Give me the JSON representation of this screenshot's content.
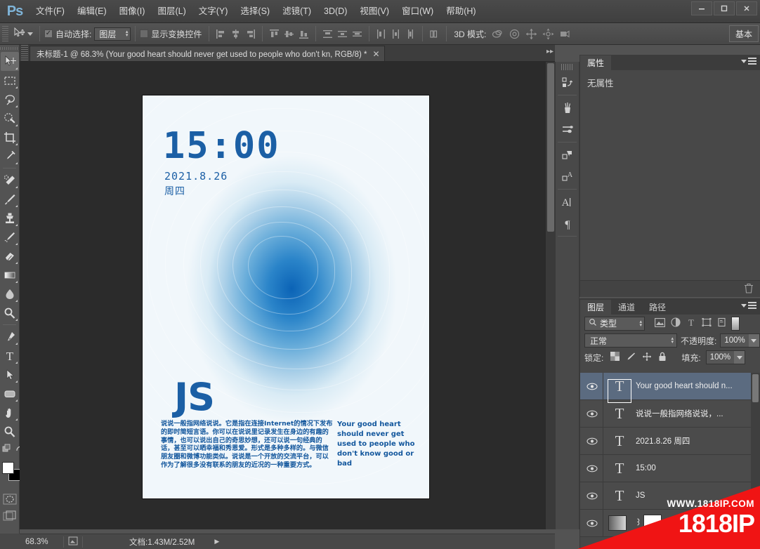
{
  "app": {
    "logo": "Ps",
    "title_suffix": ""
  },
  "window_controls": [
    {
      "name": "minimize",
      "glyph": "—"
    },
    {
      "name": "maximize",
      "glyph": "❐"
    },
    {
      "name": "close",
      "glyph": "✕"
    }
  ],
  "menubar": {
    "items": [
      {
        "label": "文件(F)"
      },
      {
        "label": "编辑(E)"
      },
      {
        "label": "图像(I)"
      },
      {
        "label": "图层(L)"
      },
      {
        "label": "文字(Y)"
      },
      {
        "label": "选择(S)"
      },
      {
        "label": "滤镜(T)"
      },
      {
        "label": "3D(D)"
      },
      {
        "label": "视图(V)"
      },
      {
        "label": "窗口(W)"
      },
      {
        "label": "帮助(H)"
      }
    ]
  },
  "options_bar": {
    "tool_icon": "move-tool-icon",
    "auto_select_label": "自动选择:",
    "auto_select_checked": "✓",
    "layer_select_value": "图层",
    "show_transform_label": "显示变换控件",
    "show_transform_checked": false,
    "mode3d_label": "3D 模式:",
    "workspace_label": "基本"
  },
  "document_tab": {
    "title": "未标题-1 @ 68.3% (Your good heart  should never get  used to people  who don't kn, RGB/8) *",
    "close_glyph": "✕"
  },
  "toolbox": {
    "tools": [
      {
        "name": "move-tool",
        "selected": true
      },
      {
        "name": "rectangular-marquee-tool",
        "selected": false
      },
      {
        "name": "lasso-tool",
        "selected": false
      },
      {
        "name": "quick-selection-tool",
        "selected": false
      },
      {
        "name": "crop-tool",
        "selected": false
      },
      {
        "name": "eyedropper-tool",
        "selected": false
      },
      {
        "name": "healing-brush-tool",
        "selected": false
      },
      {
        "name": "brush-tool",
        "selected": false
      },
      {
        "name": "clone-stamp-tool",
        "selected": false
      },
      {
        "name": "history-brush-tool",
        "selected": false
      },
      {
        "name": "eraser-tool",
        "selected": false
      },
      {
        "name": "gradient-tool",
        "selected": false
      },
      {
        "name": "blur-tool",
        "selected": false
      },
      {
        "name": "dodge-tool",
        "selected": false
      },
      {
        "name": "pen-tool",
        "selected": false
      },
      {
        "name": "horizontal-type-tool",
        "selected": false
      },
      {
        "name": "path-selection-tool",
        "selected": false
      },
      {
        "name": "rounded-rectangle-tool",
        "selected": false
      },
      {
        "name": "hand-tool",
        "selected": false
      },
      {
        "name": "zoom-tool",
        "selected": false
      }
    ],
    "foreground_color": "#ffffff",
    "background_color": "#000000"
  },
  "right_rail": {
    "buttons": [
      {
        "name": "history-panel-icon"
      },
      {
        "name": "brush-presets-icon"
      },
      {
        "name": "brush-panel-icon"
      },
      {
        "name": "paragraph-styles-icon"
      },
      {
        "name": "character-styles-icon"
      },
      {
        "name": "character-panel-icon"
      },
      {
        "name": "paragraph-panel-icon"
      }
    ]
  },
  "properties_panel": {
    "tabs": [
      {
        "label": "属性",
        "active": true
      }
    ],
    "empty_message": "无属性"
  },
  "layers_panel": {
    "tabs": [
      {
        "label": "图层",
        "active": true
      },
      {
        "label": "通道",
        "active": false
      },
      {
        "label": "路径",
        "active": false
      }
    ],
    "filter_label": "类型",
    "filter_icon": "search-icon",
    "filter_type_icons": [
      {
        "name": "filter-pixel-icon"
      },
      {
        "name": "filter-adjustment-icon"
      },
      {
        "name": "filter-type-icon"
      },
      {
        "name": "filter-shape-icon"
      },
      {
        "name": "filter-smartobject-icon"
      }
    ],
    "blend_mode": "正常",
    "opacity_label": "不透明度:",
    "opacity_value": "100%",
    "lock_label": "锁定:",
    "lock_icons": [
      {
        "name": "lock-transparency-icon"
      },
      {
        "name": "lock-image-icon"
      },
      {
        "name": "lock-position-icon"
      },
      {
        "name": "lock-all-icon"
      }
    ],
    "fill_label": "填充:",
    "fill_value": "100%",
    "layers": [
      {
        "name": "Your good heart  should n...",
        "type": "text",
        "visible": true,
        "selected": true
      },
      {
        "name": "说说一般指网络说说，...",
        "type": "text",
        "visible": true,
        "selected": false
      },
      {
        "name": "2021.8.26  周四",
        "type": "text",
        "visible": true,
        "selected": false
      },
      {
        "name": "15:00",
        "type": "text",
        "visible": true,
        "selected": false
      },
      {
        "name": "JS",
        "type": "text",
        "visible": true,
        "selected": false
      },
      {
        "name": "",
        "type": "image-with-mask",
        "visible": true,
        "selected": false
      }
    ],
    "trash_icon": "trash-icon"
  },
  "canvas": {
    "poster": {
      "time": "15:00",
      "date": "2021.8.26",
      "weekday": "周四",
      "logo": "JS",
      "chinese_text": "说说一般指网络说说。它是指在连接Internet的情况下发布的即时简短言语。你可以在说说里记录发生在身边的有趣的事情，也可以说出自己的奇思妙想，还可以说一句经典的话，甚至可以晒幸福和秀恩爱。形式是多种多样的。与微信朋友圈和微博功能类似。说说是一个开放的交流平台，可以作为了解很多没有联系的朋友的近况的一种重要方式。",
      "english_text": "Your good heart should never get used to people who don't know good or bad",
      "accent_color": "#1b5fa5"
    }
  },
  "status_bar": {
    "zoom": "68.3%",
    "doc_info": "文档:1.43M/2.52M",
    "arrow_glyph": "▶"
  },
  "watermark": {
    "url": "WWW.1818IP.COM",
    "brand": "1818IP",
    "color": "#f01414"
  }
}
